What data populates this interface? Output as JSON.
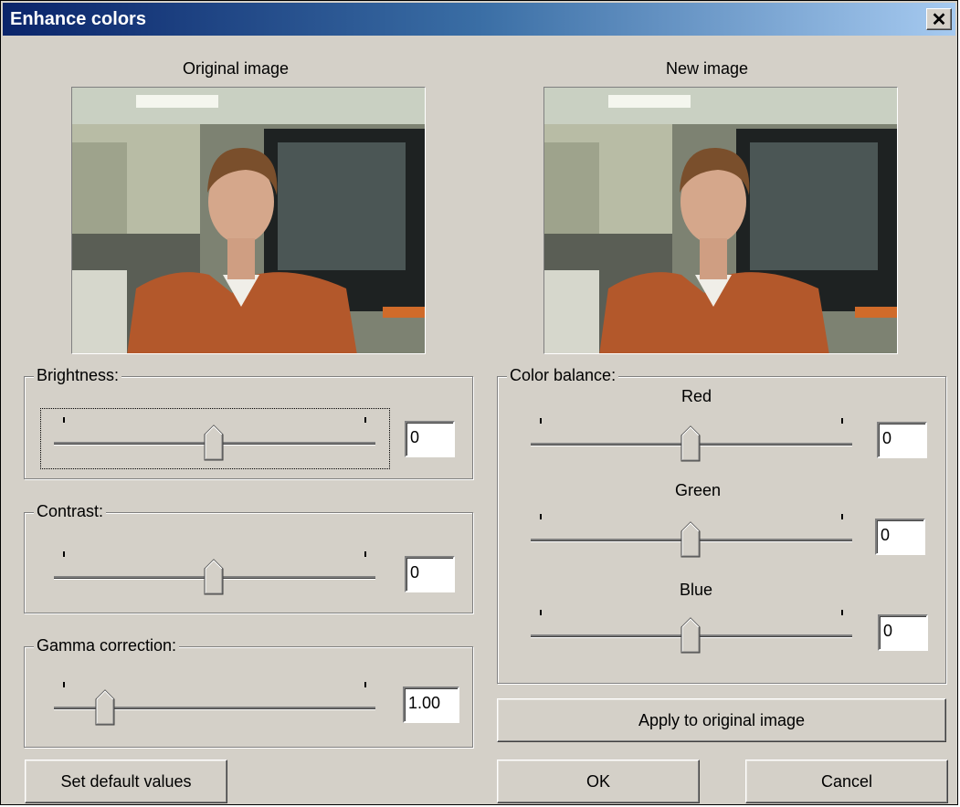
{
  "window": {
    "title": "Enhance colors"
  },
  "images": {
    "original_label": "Original image",
    "new_label": "New image"
  },
  "brightness": {
    "label": "Brightness:",
    "value": "0",
    "slider_fraction": 0.5
  },
  "contrast": {
    "label": "Contrast:",
    "value": "0",
    "slider_fraction": 0.5
  },
  "gamma": {
    "label": "Gamma correction:",
    "value": "1.00",
    "slider_fraction": 0.14
  },
  "color_balance": {
    "label": "Color balance:",
    "red": {
      "label": "Red",
      "value": "0",
      "slider_fraction": 0.5
    },
    "green": {
      "label": "Green",
      "value": "0",
      "slider_fraction": 0.5
    },
    "blue": {
      "label": "Blue",
      "value": "0",
      "slider_fraction": 0.5
    }
  },
  "buttons": {
    "apply": "Apply to original image",
    "default": "Set default values",
    "ok": "OK",
    "cancel": "Cancel"
  },
  "icons": {
    "close": "close-icon",
    "slider_thumb": "slider-thumb-icon"
  },
  "colors": {
    "dialog_bg": "#d4d0c8",
    "title_start": "#0a246a",
    "title_end": "#a6caf0"
  }
}
